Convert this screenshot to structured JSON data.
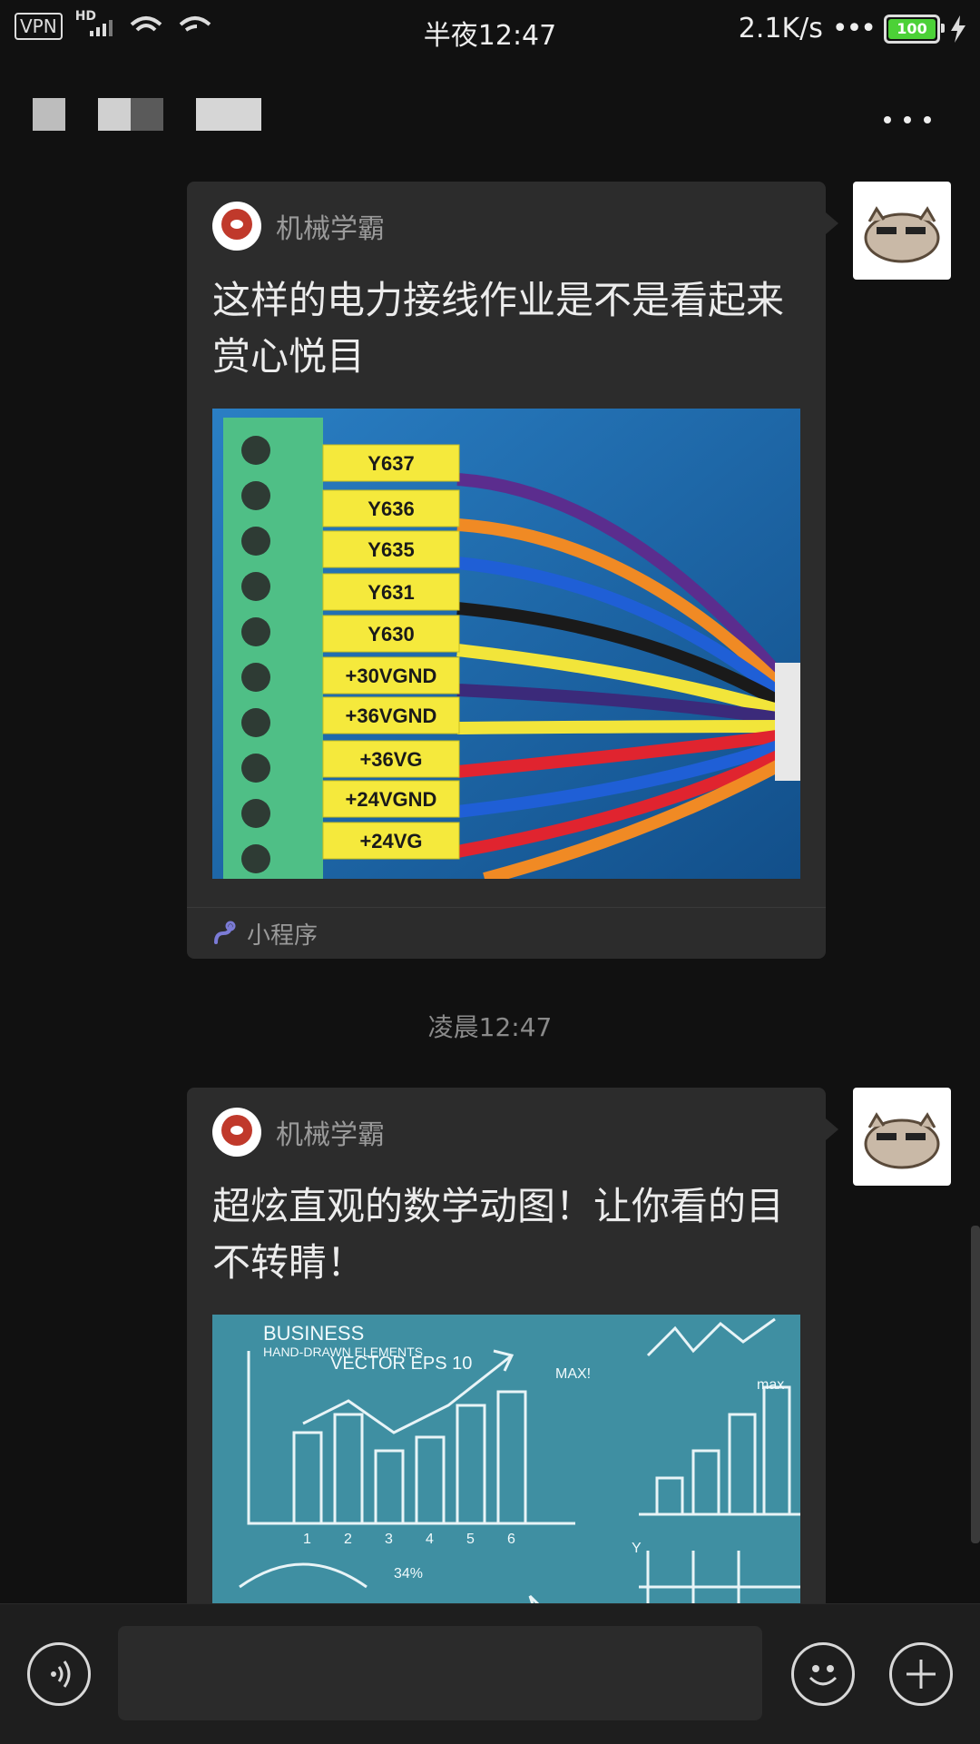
{
  "status_bar": {
    "vpn": "VPN",
    "hd": "HD",
    "time": "半夜12:47",
    "speed": "2.1K/s",
    "battery": "100"
  },
  "header": {
    "more_icon": "more-dots-icon"
  },
  "messages": [
    {
      "source": "机械学霸",
      "title": "这样的电力接线作业是不是看起来赏心悦目",
      "image_labels": [
        "Y637",
        "Y636",
        "Y635",
        "Y631",
        "Y630",
        "+30VGND",
        "+36VGND",
        "+36VG",
        "+24VGND",
        "+24VG"
      ],
      "footer_label": "小程序"
    },
    {
      "source": "机械学霸",
      "title": "超炫直观的数学动图！让你看的目不转睛！",
      "image_labels": [
        "BUSINESS",
        "HAND-DRAWN ELEMENTS",
        "VECTOR EPS 10",
        "MAX!",
        "max",
        "34%",
        "Y"
      ],
      "chart_axis": [
        "1",
        "2",
        "3",
        "4",
        "5",
        "6"
      ]
    }
  ],
  "timestamp": "凌晨12:47",
  "bottom_bar": {
    "voice_icon": "voice-icon",
    "emoji_icon": "emoji-icon",
    "plus_icon": "plus-icon"
  }
}
